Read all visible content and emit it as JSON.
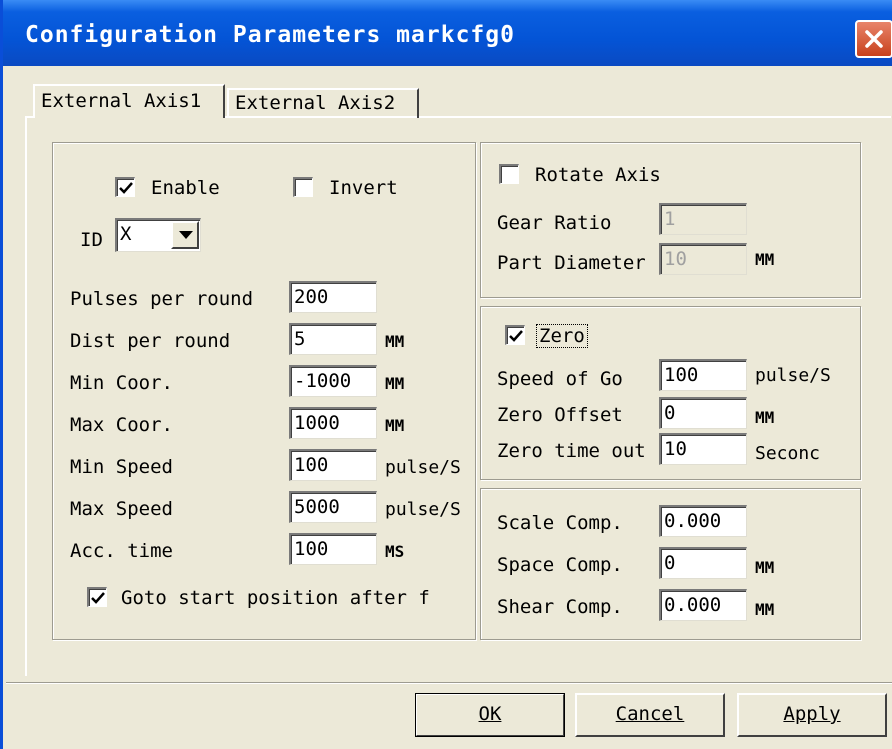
{
  "window": {
    "title": "Configuration Parameters markcfg0"
  },
  "tabs": [
    {
      "label": "External Axis1",
      "active": true
    },
    {
      "label": "External Axis2",
      "active": false
    }
  ],
  "axis": {
    "enable": {
      "label": "Enable",
      "checked": true
    },
    "invert": {
      "label": "Invert",
      "checked": false
    },
    "id": {
      "label": "ID",
      "value": "X"
    },
    "fields": [
      {
        "label": "Pulses per round",
        "value": "200",
        "unit": ""
      },
      {
        "label": "Dist per round",
        "value": "5",
        "unit": "MM"
      },
      {
        "label": "Min Coor.",
        "value": "-1000",
        "unit": "MM"
      },
      {
        "label": "Max Coor.",
        "value": "1000",
        "unit": "MM"
      },
      {
        "label": "Min Speed",
        "value": "100",
        "unit": "pulse/S"
      },
      {
        "label": "Max Speed",
        "value": "5000",
        "unit": "pulse/S"
      },
      {
        "label": "Acc. time",
        "value": "100",
        "unit": "MS"
      }
    ],
    "goto_start": {
      "label": "Goto start position after f",
      "checked": true
    }
  },
  "rotate": {
    "checkbox": {
      "label": "Rotate Axis",
      "checked": false
    },
    "gear_ratio": {
      "label": "Gear Ratio",
      "value": "1"
    },
    "part_diameter": {
      "label": "Part Diameter",
      "value": "10",
      "unit": "MM"
    }
  },
  "zero": {
    "checkbox": {
      "label": "Zero",
      "checked": true
    },
    "speed": {
      "label": "Speed of Go",
      "value": "100",
      "unit": "pulse/S"
    },
    "offset": {
      "label": "Zero Offset",
      "value": "0",
      "unit": "MM"
    },
    "timeout": {
      "label": "Zero time out",
      "value": "10",
      "unit": "Seconc"
    }
  },
  "comp": {
    "scale": {
      "label": "Scale Comp.",
      "value": "0.000",
      "unit": ""
    },
    "space": {
      "label": "Space Comp.",
      "value": "0",
      "unit": "MM"
    },
    "shear": {
      "label": "Shear Comp.",
      "value": "0.000",
      "unit": "MM"
    }
  },
  "buttons": {
    "ok": "OK",
    "cancel": "Cancel",
    "apply": "Apply"
  },
  "colors": {
    "title_bar": "#0454d6",
    "face": "#ece9d8",
    "close": "#c8411d"
  }
}
